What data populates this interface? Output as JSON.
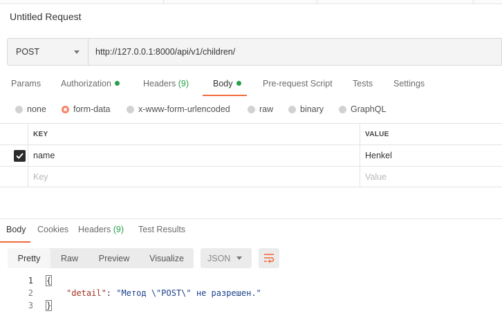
{
  "request": {
    "title": "Untitled Request",
    "method": "POST",
    "url": "http://127.0.0.1:8000/api/v1/children/"
  },
  "request_tabs": [
    {
      "label": "Params"
    },
    {
      "label": "Authorization",
      "indicator": "green-dot"
    },
    {
      "label": "Headers",
      "count": "(9)"
    },
    {
      "label": "Body",
      "indicator": "green-dot",
      "active": true
    },
    {
      "label": "Pre-request Script"
    },
    {
      "label": "Tests"
    },
    {
      "label": "Settings"
    }
  ],
  "body_types": [
    {
      "label": "none",
      "checked": false
    },
    {
      "label": "form-data",
      "checked": true
    },
    {
      "label": "x-www-form-urlencoded",
      "checked": false
    },
    {
      "label": "raw",
      "checked": false
    },
    {
      "label": "binary",
      "checked": false
    },
    {
      "label": "GraphQL",
      "checked": false
    }
  ],
  "form_table": {
    "headers": {
      "key": "KEY",
      "value": "VALUE"
    },
    "rows": [
      {
        "key": "name",
        "value": "Henkel",
        "checked": true
      }
    ],
    "placeholder": {
      "key": "Key",
      "value": "Value"
    }
  },
  "response_tabs": [
    {
      "label": "Body",
      "active": true
    },
    {
      "label": "Cookies"
    },
    {
      "label": "Headers",
      "count": "(9)"
    },
    {
      "label": "Test Results"
    }
  ],
  "view_modes": [
    "Pretty",
    "Raw",
    "Preview",
    "Visualize"
  ],
  "active_view_mode": "Pretty",
  "format_select": "JSON",
  "response_code": {
    "line_numbers": [
      "1",
      "2",
      "3"
    ],
    "open_brace": "{",
    "key": "\"detail\"",
    "colon": ": ",
    "value": "\"Метод \\\"POST\\\" не разрешен.\"",
    "close_brace": "}"
  },
  "colors": {
    "accent": "#f26b3a",
    "status_green": "#26a04a",
    "json_key": "#a3321f",
    "json_string": "#1b3f8a"
  },
  "icons": [
    "chevron-down-icon",
    "check-icon",
    "wrap-lines-icon"
  ]
}
